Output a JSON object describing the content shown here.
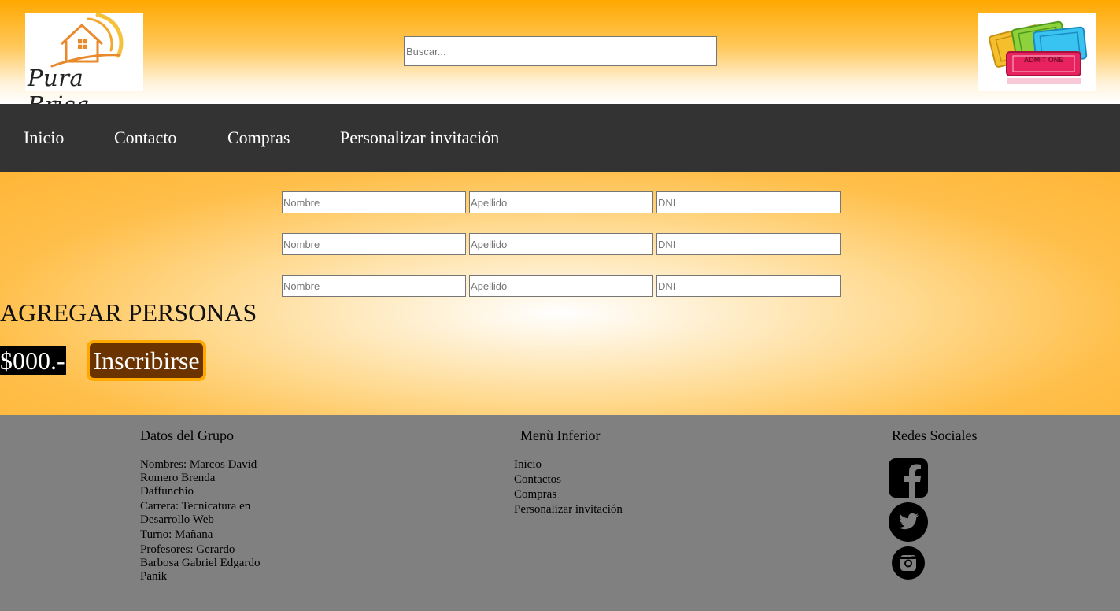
{
  "header": {
    "logo_text": "Pura Brisa",
    "search_placeholder": "Buscar...",
    "tickets_text": "ADMIT ONE"
  },
  "nav": {
    "items": [
      {
        "label": "Inicio"
      },
      {
        "label": "Contacto"
      },
      {
        "label": "Compras"
      },
      {
        "label": "Personalizar invitación"
      }
    ]
  },
  "form": {
    "rows": [
      {
        "nombre_placeholder": "Nombre",
        "apellido_placeholder": "Apellido",
        "dni_placeholder": "DNI"
      },
      {
        "nombre_placeholder": "Nombre",
        "apellido_placeholder": "Apellido",
        "dni_placeholder": "DNI"
      },
      {
        "nombre_placeholder": "Nombre",
        "apellido_placeholder": "Apellido",
        "dni_placeholder": "DNI"
      }
    ],
    "add_people_label": "AGREGAR PERSONAS",
    "price": "$000.-",
    "submit_label": "Inscribirse"
  },
  "footer": {
    "group": {
      "title": "Datos del Grupo",
      "lines": [
        "Nombres: Marcos David Romero Brenda Daffunchio",
        "Carrera: Tecnicatura en Desarrollo Web",
        "Turno: Mañana",
        "Profesores: Gerardo Barbosa Gabriel Edgardo Panik"
      ]
    },
    "menu": {
      "title": "Menù Inferior",
      "links": [
        "Inicio",
        "Contactos",
        "Compras",
        "Personalizar invitación"
      ]
    },
    "social": {
      "title": "Redes Sociales",
      "icons": [
        "facebook-icon",
        "twitter-icon",
        "instagram-icon"
      ]
    }
  },
  "colors": {
    "header_top": "#ffa800",
    "nav_bg": "#333333",
    "button_bg": "#6a3300",
    "button_border": "#ffa800",
    "footer_bg": "#808080"
  }
}
